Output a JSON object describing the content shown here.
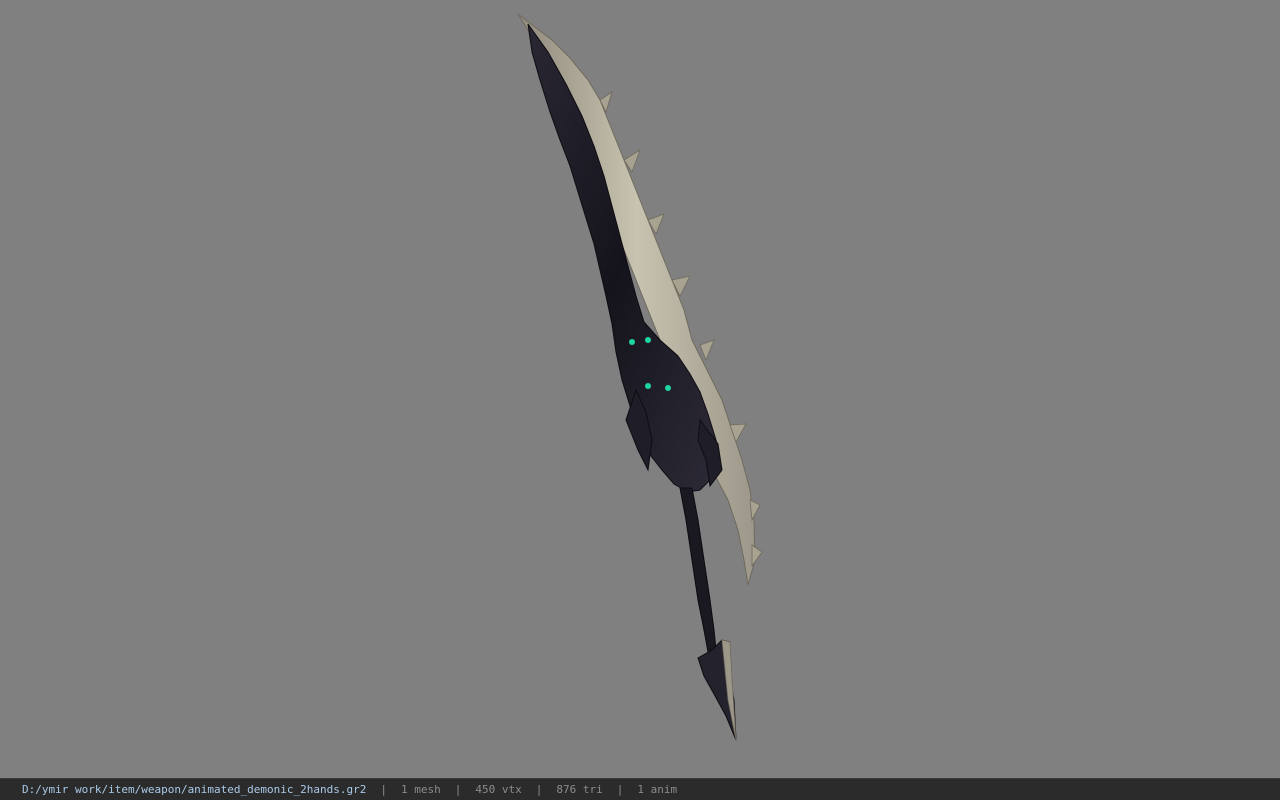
{
  "status_bar": {
    "file_path": "D:/ymir work/item/weapon/animated_demonic_2hands.gr2",
    "separator": "|",
    "mesh_count": "1 mesh",
    "vertex_count": "450 vtx",
    "triangle_count": "876 tri",
    "anim_count": "1 anim"
  },
  "colors": {
    "viewport_background": "#808080",
    "status_background": "#2b2b2b",
    "path_text": "#a9c9e8",
    "stat_text": "#8c8c8c",
    "blade_bone": "#b9b3a1",
    "blade_dark": "#1c1a24",
    "eye_glow": "#1fd6a0"
  },
  "viewport": {
    "model": "demonic-two-handed-sword"
  }
}
